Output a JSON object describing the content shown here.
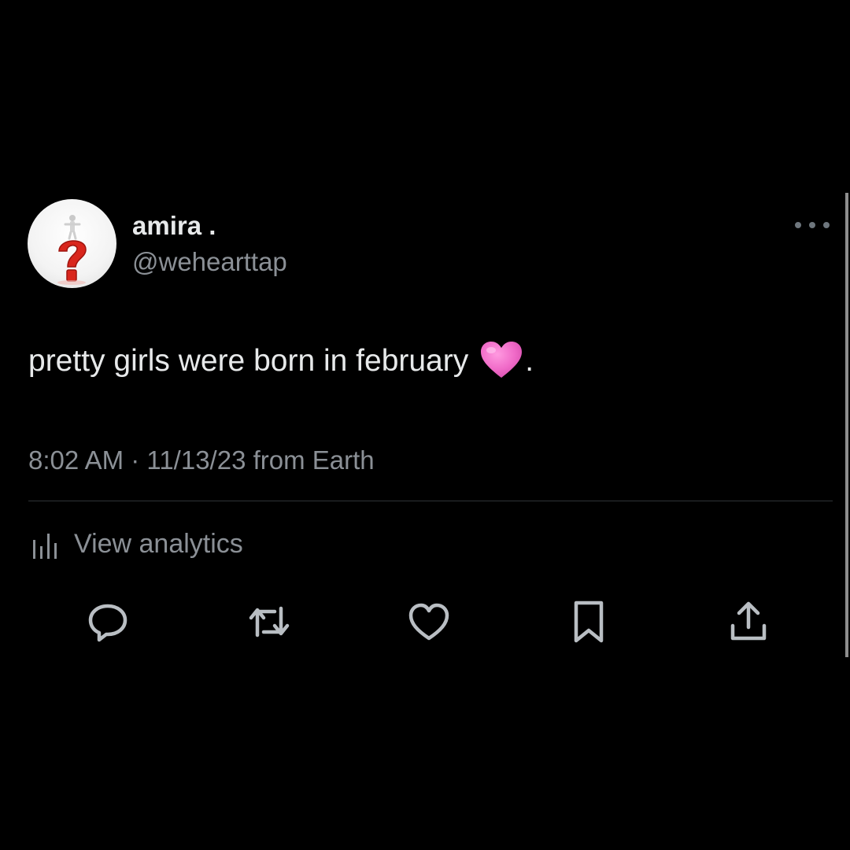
{
  "tweet": {
    "display_name": "amira .",
    "handle": "@wehearttap",
    "text": "pretty girls were born in february",
    "text_end": ".",
    "emoji": "pink-heart-emoji",
    "time": "8:02 AM",
    "separator": "·",
    "date": "11/13/23",
    "source": "from Earth"
  },
  "analytics": {
    "label": "View analytics",
    "icon": "bar-chart-icon"
  },
  "actions": [
    {
      "icon": "reply-icon"
    },
    {
      "icon": "retweet-icon"
    },
    {
      "icon": "like-icon"
    },
    {
      "icon": "bookmark-icon"
    },
    {
      "icon": "share-icon"
    }
  ],
  "colors": {
    "background": "#000000",
    "primary_text": "#e7e9ea",
    "secondary_text": "#8b9096",
    "divider": "#2f3336",
    "icon": "#b9bec3",
    "heart_pink": "#f06bc8"
  }
}
